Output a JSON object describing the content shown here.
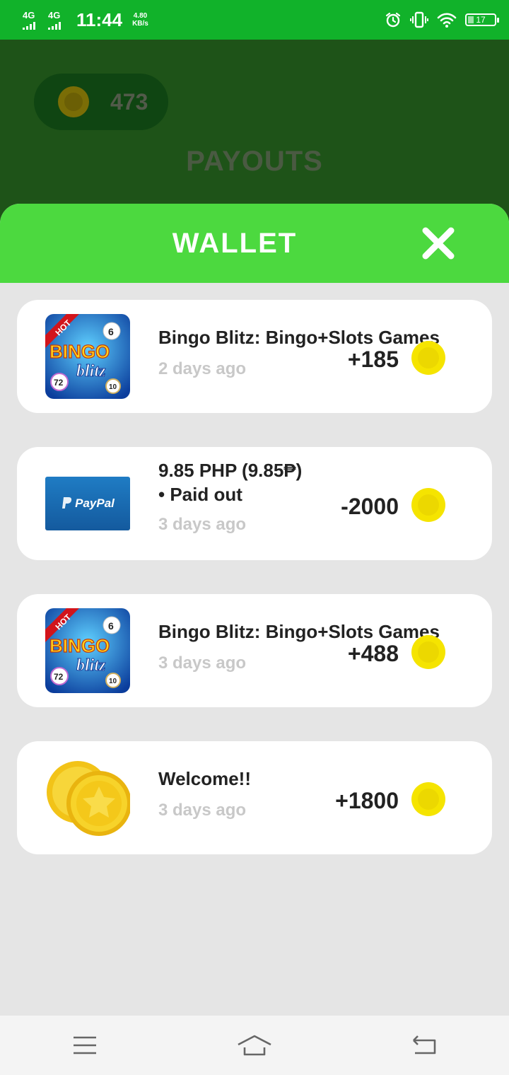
{
  "status_bar": {
    "network_1": "4G",
    "network_2": "4G",
    "time": "11:44",
    "speed_value": "4.80",
    "speed_unit": "KB/s",
    "battery": "17",
    "icons": [
      "alarm-icon",
      "vibrate-icon",
      "wifi-icon",
      "battery-icon"
    ]
  },
  "background": {
    "balance": "473",
    "screen_title": "PAYOUTS"
  },
  "wallet": {
    "title": "WALLET",
    "close_icon": "close-icon",
    "header_color": "#4cd93f",
    "items": [
      {
        "title": "Bingo Blitz: Bingo+Slots Games",
        "title_line2": "",
        "date": "2 days ago",
        "amount": "+185",
        "icon": "bingo-blitz-app-icon"
      },
      {
        "title": "9.85 PHP (9.85₱)",
        "title_line2": "• Paid out",
        "date": "3 days ago",
        "amount": "-2000",
        "icon": "paypal-logo",
        "logo_text": "PayPal"
      },
      {
        "title": "Bingo Blitz: Bingo+Slots Games",
        "title_line2": "",
        "date": "3 days ago",
        "amount": "+488",
        "icon": "bingo-blitz-app-icon"
      },
      {
        "title": "Welcome!!",
        "title_line2": "",
        "date": "3 days ago",
        "amount": "+1800",
        "icon": "gold-coins-icon"
      }
    ]
  },
  "bingo_icon": {
    "hot": "HOT",
    "word1": "BINGO",
    "word2": "blitz",
    "ball_a": "6",
    "ball_b": "72",
    "ball_c": "10"
  },
  "nav_bar": {
    "icons": [
      "menu-icon",
      "home-icon",
      "back-icon"
    ]
  },
  "colors": {
    "status_bar": "#11b22a",
    "dark_bg": "#1e5318",
    "coin": "#f5e400"
  }
}
